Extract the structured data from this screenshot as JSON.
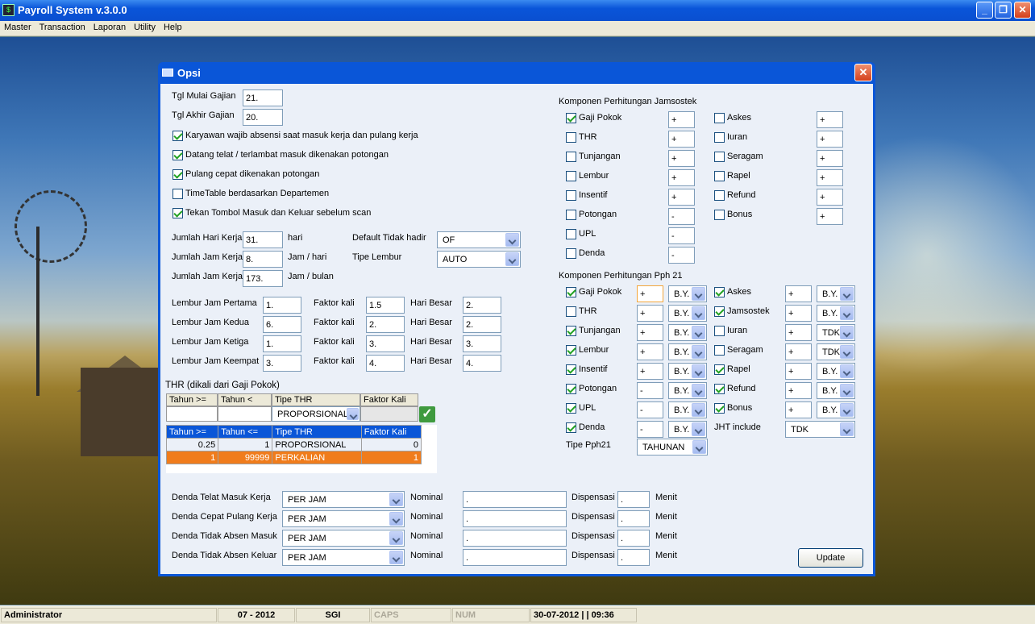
{
  "app": {
    "title": "Payroll System v.3.0.0",
    "icon": "app-icon"
  },
  "menu": [
    "Master",
    "Transaction",
    "Laporan",
    "Utility",
    "Help"
  ],
  "dialog": {
    "title": "Opsi",
    "close": "✕"
  },
  "general": {
    "tgl_mulai_label": "Tgl Mulai Gajian",
    "tgl_mulai": "21.",
    "tgl_akhir_label": "Tgl Akhir Gajian",
    "tgl_akhir": "20.",
    "checks": [
      {
        "label": "Karyawan wajib absensi saat masuk kerja dan pulang kerja",
        "checked": true
      },
      {
        "label": "Datang telat / terlambat masuk dikenakan potongan",
        "checked": true
      },
      {
        "label": "Pulang cepat dikenakan potongan",
        "checked": true
      },
      {
        "label": "TimeTable berdasarkan Departemen",
        "checked": false
      },
      {
        "label": "Tekan Tombol Masuk dan Keluar sebelum scan",
        "checked": true
      }
    ],
    "hari_kerja_label": "Jumlah Hari Kerja",
    "hari_kerja": "31.",
    "hari_unit": "hari",
    "jam_kerja_label": "Jumlah Jam Kerja",
    "jam_kerja": "8.",
    "jam_unit": "Jam / hari",
    "jam_kerja2_label": "Jumlah Jam Kerja",
    "jam_kerja2": "173.",
    "jam2_unit": "Jam / bulan",
    "default_tidak_hadir_label": "Default Tidak hadir",
    "default_tidak_hadir": "OF",
    "tipe_lembur_label": "Tipe Lembur",
    "tipe_lembur": "AUTO"
  },
  "lembur": {
    "faktor_label": "Faktor kali",
    "hari_besar_label": "Hari Besar",
    "rows": [
      {
        "label": "Lembur Jam Pertama",
        "jam": "1.",
        "faktor": "1.5",
        "hari_besar": "2."
      },
      {
        "label": "Lembur Jam Kedua",
        "jam": "6.",
        "faktor": "2.",
        "hari_besar": "2."
      },
      {
        "label": "Lembur Jam Ketiga",
        "jam": "1.",
        "faktor": "3.",
        "hari_besar": "3."
      },
      {
        "label": "Lembur Jam Keempat",
        "jam": "3.",
        "faktor": "4.",
        "hari_besar": "4."
      }
    ]
  },
  "thr": {
    "title": "THR (dikali dari Gaji Pokok)",
    "input_headers": [
      "Tahun >=",
      "Tahun <",
      "Tipe THR",
      "Faktor Kali"
    ],
    "input_tipe": "PROPORSIONAL",
    "grid_headers": [
      "Tahun >=",
      "Tahun <=",
      "Tipe THR",
      "Faktor Kali"
    ],
    "rows": [
      [
        "0.25",
        "1",
        "PROPORSIONAL",
        "0"
      ],
      [
        "1",
        "99999",
        "PERKALIAN",
        "1"
      ]
    ]
  },
  "denda": {
    "nominal_label": "Nominal",
    "dispensasi_label": "Dispensasi",
    "menit_label": "Menit",
    "rows": [
      {
        "label": "Denda Telat Masuk Kerja",
        "tipe": "PER JAM",
        "nominal": ".",
        "dispensasi": "."
      },
      {
        "label": "Denda Cepat Pulang Kerja",
        "tipe": "PER JAM",
        "nominal": ".",
        "dispensasi": "."
      },
      {
        "label": "Denda Tidak Absen Masuk",
        "tipe": "PER JAM",
        "nominal": ".",
        "dispensasi": "."
      },
      {
        "label": "Denda Tidak Absen Keluar",
        "tipe": "PER JAM",
        "nominal": ".",
        "dispensasi": "."
      }
    ]
  },
  "jamsostek": {
    "title": "Komponen Perhitungan Jamsostek",
    "left": [
      {
        "label": "Gaji Pokok",
        "checked": true,
        "sign": "+"
      },
      {
        "label": "THR",
        "checked": false,
        "sign": "+"
      },
      {
        "label": "Tunjangan",
        "checked": false,
        "sign": "+"
      },
      {
        "label": "Lembur",
        "checked": false,
        "sign": "+"
      },
      {
        "label": "Insentif",
        "checked": false,
        "sign": "+"
      },
      {
        "label": "Potongan",
        "checked": false,
        "sign": "-"
      },
      {
        "label": "UPL",
        "checked": false,
        "sign": "-"
      },
      {
        "label": "Denda",
        "checked": false,
        "sign": "-"
      }
    ],
    "right": [
      {
        "label": "Askes",
        "checked": false,
        "sign": "+"
      },
      {
        "label": "Iuran",
        "checked": false,
        "sign": "+"
      },
      {
        "label": "Seragam",
        "checked": false,
        "sign": "+"
      },
      {
        "label": "Rapel",
        "checked": false,
        "sign": "+"
      },
      {
        "label": "Refund",
        "checked": false,
        "sign": "+"
      },
      {
        "label": "Bonus",
        "checked": false,
        "sign": "+"
      }
    ]
  },
  "pph21": {
    "title": "Komponen Perhitungan Pph 21",
    "left": [
      {
        "label": "Gaji Pokok",
        "checked": true,
        "sign": "+",
        "tipe": "B.Y."
      },
      {
        "label": "THR",
        "checked": false,
        "sign": "+",
        "tipe": "B.Y."
      },
      {
        "label": "Tunjangan",
        "checked": true,
        "sign": "+",
        "tipe": "B.Y."
      },
      {
        "label": "Lembur",
        "checked": true,
        "sign": "+",
        "tipe": "B.Y."
      },
      {
        "label": "Insentif",
        "checked": true,
        "sign": "+",
        "tipe": "B.Y."
      },
      {
        "label": "Potongan",
        "checked": true,
        "sign": "-",
        "tipe": "B.Y."
      },
      {
        "label": "UPL",
        "checked": true,
        "sign": "-",
        "tipe": "B.Y."
      },
      {
        "label": "Denda",
        "checked": true,
        "sign": "-",
        "tipe": "B.Y."
      }
    ],
    "right": [
      {
        "label": "Askes",
        "checked": true,
        "sign": "+",
        "tipe": "B.Y."
      },
      {
        "label": "Jamsostek",
        "checked": true,
        "sign": "+",
        "tipe": "B.Y."
      },
      {
        "label": "Iuran",
        "checked": false,
        "sign": "+",
        "tipe": "TDK"
      },
      {
        "label": "Seragam",
        "checked": false,
        "sign": "+",
        "tipe": "TDK"
      },
      {
        "label": "Rapel",
        "checked": true,
        "sign": "+",
        "tipe": "B.Y."
      },
      {
        "label": "Refund",
        "checked": true,
        "sign": "+",
        "tipe": "B.Y."
      },
      {
        "label": "Bonus",
        "checked": true,
        "sign": "+",
        "tipe": "B.Y."
      }
    ],
    "jht_label": "JHT include",
    "jht": "TDK",
    "tipe_label": "Tipe Pph21",
    "tipe": "TAHUNAN"
  },
  "update_label": "Update",
  "status": {
    "user": "Administrator",
    "period": "07 - 2012",
    "company": "SGI",
    "caps": "CAPS",
    "num": "NUM",
    "datetime": "30-07-2012 | | 09:36"
  }
}
